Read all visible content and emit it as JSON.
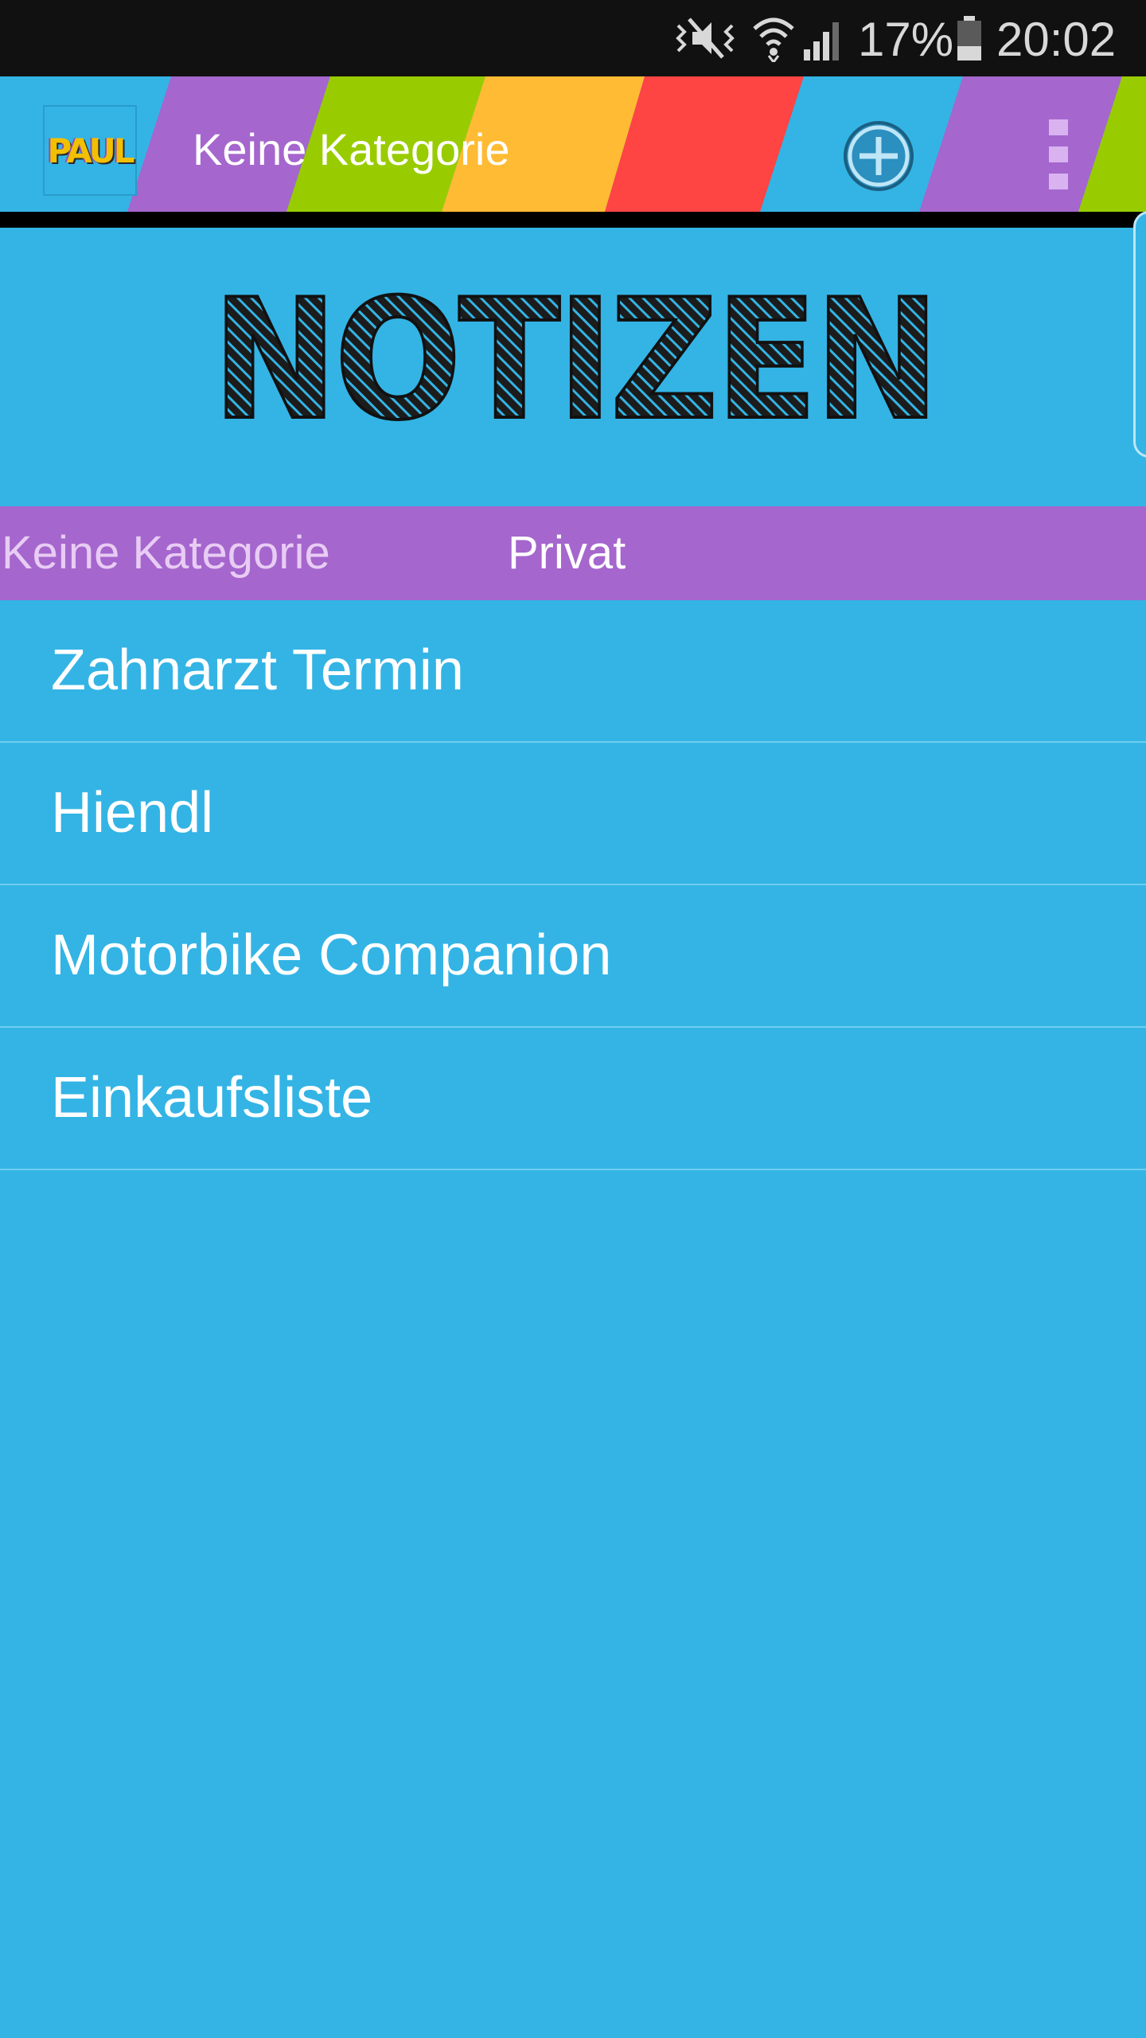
{
  "status_bar": {
    "battery_percent": "17%",
    "time": "20:02",
    "icons": [
      "mute-icon",
      "wifi-icon",
      "signal-icon",
      "battery-icon"
    ]
  },
  "action_bar": {
    "logo_text": "PAUL",
    "title": "Keine Kategorie",
    "stripe_colors": [
      "#33b4e5",
      "#a566cd",
      "#99cc00",
      "#ffbb33",
      "#ff4444"
    ],
    "icons": [
      "app-logo",
      "add-circle-icon",
      "overflow-menu-icon"
    ]
  },
  "header": {
    "title": "NOTIZEN"
  },
  "tabs": [
    {
      "label": "Keine Kategorie"
    },
    {
      "label": "Privat"
    }
  ],
  "notes": [
    {
      "title": "Zahnarzt Termin"
    },
    {
      "title": "Hiendl"
    },
    {
      "title": "Motorbike Companion"
    },
    {
      "title": "Einkaufsliste"
    }
  ],
  "colors": {
    "background": "#33b4e5",
    "tab_bar": "#a566cd",
    "status_bar": "#111111"
  }
}
